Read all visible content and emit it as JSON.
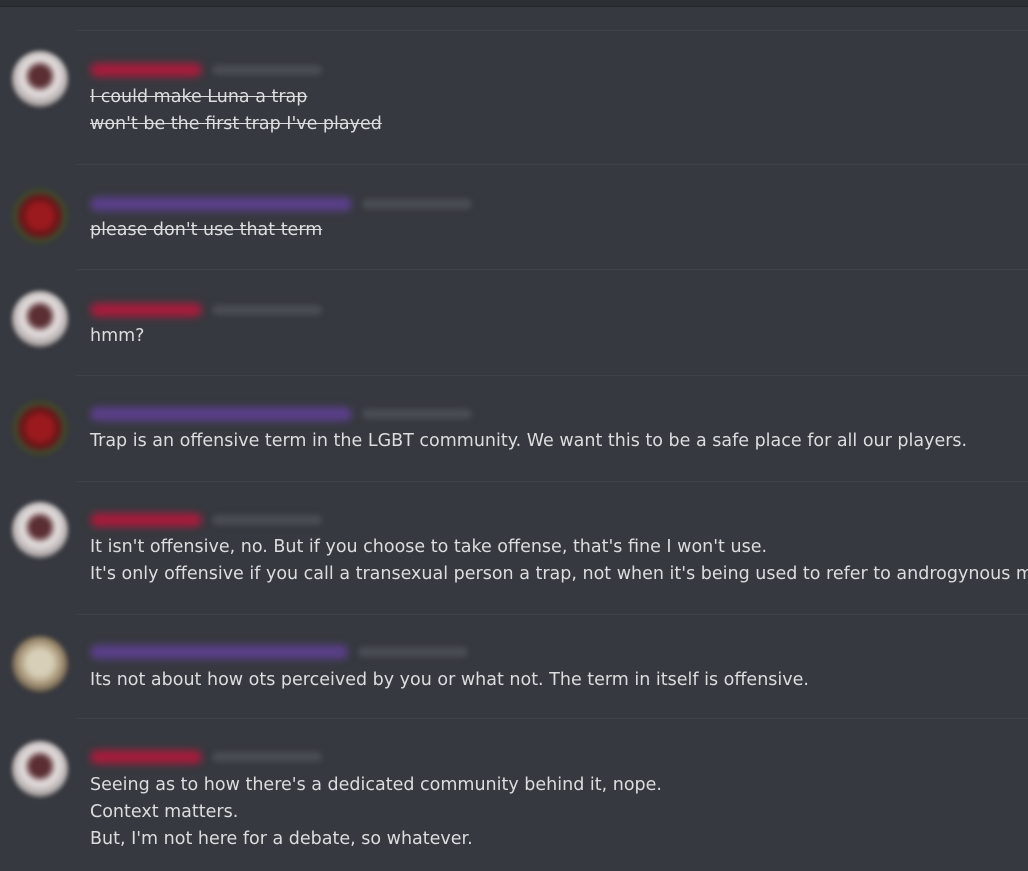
{
  "messages": [
    {
      "author_color": "#a51c3c",
      "avatar": "avatar-user-a",
      "lines": [
        "I could make Luna a trap",
        "won't be the first trap I've played"
      ],
      "struck": true
    },
    {
      "author_color": "#5a3f8a",
      "avatar": "avatar-user-b",
      "lines": [
        "please don't use that term"
      ],
      "struck": true
    },
    {
      "author_color": "#a51c3c",
      "avatar": "avatar-user-a",
      "lines": [
        "hmm?"
      ],
      "struck": false
    },
    {
      "author_color": "#5a3f8a",
      "avatar": "avatar-user-b",
      "lines": [
        "Trap is an offensive term in the LGBT community. We want this to be a safe place for all our players."
      ],
      "struck": false
    },
    {
      "author_color": "#a51c3c",
      "avatar": "avatar-user-a",
      "lines": [
        "It isn't offensive, no. But if you choose to take offense, that's fine I won't use.",
        "It's only offensive if you call a transexual person a trap, not when it's being used to refer to androgynous males."
      ],
      "struck": false
    },
    {
      "author_color": "#5a3f8a",
      "avatar": "avatar-user-c",
      "lines": [
        "Its  not about how ots perceived by you or what not. The term in itself is offensive."
      ],
      "struck": false
    },
    {
      "author_color": "#a51c3c",
      "avatar": "avatar-user-a",
      "lines": [
        "Seeing as to how there's a dedicated community behind it, nope.",
        "Context matters.",
        "But, I'm not here for a debate, so whatever."
      ],
      "struck": false
    }
  ]
}
